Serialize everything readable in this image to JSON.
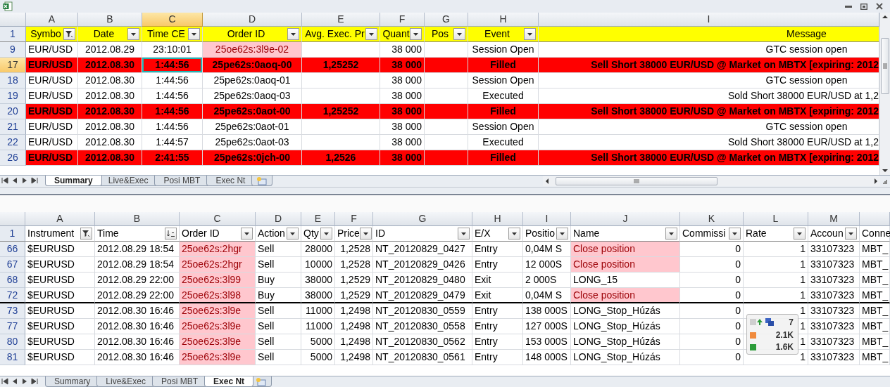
{
  "top_sheet": {
    "columns": [
      {
        "letter": "A",
        "heading": "Symbo",
        "kind": "filter",
        "selected": false
      },
      {
        "letter": "B",
        "heading": "Date",
        "kind": "dropdown",
        "selected": false
      },
      {
        "letter": "C",
        "heading": "Time CE",
        "kind": "dropdown",
        "selected": true
      },
      {
        "letter": "D",
        "heading": "Order ID",
        "kind": "dropdown",
        "selected": false
      },
      {
        "letter": "E",
        "heading": "Avg. Exec. Pr",
        "kind": "dropdown",
        "selected": false
      },
      {
        "letter": "F",
        "heading": "Quant",
        "kind": "dropdown",
        "selected": false
      },
      {
        "letter": "G",
        "heading": "Pos",
        "kind": "dropdown",
        "selected": false
      },
      {
        "letter": "H",
        "heading": "Event",
        "kind": "dropdown",
        "selected": false
      },
      {
        "letter": "I",
        "heading": "Message",
        "selected": false
      }
    ],
    "header_row": "1",
    "rows": [
      {
        "number": "9",
        "kind": "normal",
        "selected": false,
        "cells": [
          "EUR/USD",
          "2012.08.29",
          "23:10:01",
          {
            "text": "25oe62s:3l9e-02",
            "highlight": true
          },
          null,
          "38 000",
          null,
          "Session Open",
          "GTC session open"
        ]
      },
      {
        "number": "17",
        "kind": "filled",
        "selected": true,
        "cells": [
          "EUR/USD",
          "2012.08.30",
          {
            "text": "1:44:56",
            "active": true
          },
          "25pe62s:0aoq-00",
          "1,25252",
          "38 000",
          null,
          "Filled",
          "Sell Short 38000 EUR/USD @ Market on MBTX [expiring: 2012"
        ]
      },
      {
        "number": "18",
        "kind": "normal",
        "selected": false,
        "cells": [
          "EUR/USD",
          "2012.08.30",
          "1:44:56",
          "25pe62s:0aoq-01",
          null,
          "38 000",
          null,
          "Session Open",
          "GTC session open"
        ]
      },
      {
        "number": "19",
        "kind": "normal",
        "selected": false,
        "cells": [
          "EUR/USD",
          "2012.08.30",
          "1:44:56",
          "25pe62s:0aoq-03",
          null,
          "38 000",
          null,
          "Executed",
          "Sold Short 38000 EUR/USD at 1,2"
        ]
      },
      {
        "number": "20",
        "kind": "filled",
        "selected": false,
        "cells": [
          "EUR/USD",
          "2012.08.30",
          "1:44:56",
          "25pe62s:0aot-00",
          "1,25252",
          "38 000",
          null,
          "Filled",
          "Sell Short 38000 EUR/USD @ Market on MBTX [expiring: 2012"
        ]
      },
      {
        "number": "21",
        "kind": "normal",
        "selected": false,
        "cells": [
          "EUR/USD",
          "2012.08.30",
          "1:44:56",
          "25pe62s:0aot-01",
          null,
          "38 000",
          null,
          "Session Open",
          "GTC session open"
        ]
      },
      {
        "number": "22",
        "kind": "normal",
        "selected": false,
        "cells": [
          "EUR/USD",
          "2012.08.30",
          "1:44:57",
          "25pe62s:0aot-03",
          null,
          "38 000",
          null,
          "Executed",
          "Sold Short 38000 EUR/USD at 1,2"
        ]
      },
      {
        "number": "26",
        "kind": "filled",
        "selected": false,
        "cells": [
          "EUR/USD",
          "2012.08.30",
          "2:41:55",
          "25pe62s:0jch-00",
          "1,2526",
          "38 000",
          null,
          "Filled",
          "Sell Short 38000 EUR/USD @ Market on MBTX [expiring: 2012"
        ]
      }
    ],
    "tabs": [
      {
        "label": "Summary",
        "selected": true
      },
      {
        "label": "Live&Exec",
        "selected": false
      },
      {
        "label": "Posi MBT",
        "selected": false
      },
      {
        "label": "Exec Nt",
        "selected": false
      }
    ]
  },
  "bottom_sheet": {
    "columns": [
      {
        "letter": "A",
        "heading": "Instrument",
        "kind": "filter",
        "selected": false
      },
      {
        "letter": "B",
        "heading": "Time",
        "kind": "sort",
        "selected": false
      },
      {
        "letter": "C",
        "heading": "Order ID",
        "kind": "dropdown",
        "selected": false
      },
      {
        "letter": "D",
        "heading": "Action",
        "kind": "dropdown",
        "selected": false
      },
      {
        "letter": "E",
        "heading": "Qty",
        "kind": "dropdown",
        "selected": false
      },
      {
        "letter": "F",
        "heading": "Price",
        "kind": "dropdown",
        "selected": false
      },
      {
        "letter": "G",
        "heading": "ID",
        "kind": "dropdown",
        "selected": false
      },
      {
        "letter": "H",
        "heading": "E/X",
        "kind": "dropdown",
        "selected": false
      },
      {
        "letter": "I",
        "heading": "Positio",
        "kind": "dropdown",
        "selected": false
      },
      {
        "letter": "J",
        "heading": "Name",
        "kind": "dropdown",
        "selected": false
      },
      {
        "letter": "K",
        "heading": "Commissi",
        "kind": "dropdown",
        "selected": false
      },
      {
        "letter": "L",
        "heading": "Rate",
        "kind": "dropdown",
        "selected": false
      },
      {
        "letter": "M",
        "heading": "Accoun",
        "kind": "dropdown",
        "selected": false
      },
      {
        "heading": "Conne",
        "selected": false
      }
    ],
    "header_row": "1",
    "rows": [
      {
        "number": "66",
        "selected": false,
        "border_below": false,
        "cells": [
          "$EURUSD",
          "2012.08.29 18:54",
          {
            "text": "25oe62s:2hgr",
            "highlight": true
          },
          "Sell",
          "28000",
          "1,2528",
          "NT_20120829_0427",
          "Entry",
          "0,04M S",
          {
            "text": "Close position",
            "highlight": true
          },
          "0",
          "1",
          "33107323",
          "MBT_"
        ]
      },
      {
        "number": "67",
        "selected": false,
        "border_below": false,
        "cells": [
          "$EURUSD",
          "2012.08.29 18:54",
          {
            "text": "25oe62s:2hgr",
            "highlight": true
          },
          "Sell",
          "10000",
          "1,2528",
          "NT_20120829_0426",
          "Entry",
          "12 000S",
          {
            "text": "Close position",
            "highlight": true
          },
          "0",
          "1",
          "33107323",
          "MBT_"
        ]
      },
      {
        "number": "68",
        "selected": false,
        "border_below": false,
        "cells": [
          "$EURUSD",
          "2012.08.29 22:00",
          {
            "text": "25oe62s:3l99",
            "highlight": true
          },
          "Buy",
          "38000",
          "1,2529",
          "NT_20120829_0480",
          "Exit",
          "2 000S",
          "LONG_15",
          "0",
          "1",
          "33107323",
          "MBT_"
        ]
      },
      {
        "number": "72",
        "selected": false,
        "border_below": true,
        "cells": [
          "$EURUSD",
          "2012.08.29 22:00",
          {
            "text": "25oe62s:3l98",
            "highlight": true
          },
          "Buy",
          "38000",
          "1,2529",
          "NT_20120829_0479",
          "Exit",
          "0,04M S",
          {
            "text": "Close position",
            "highlight": true
          },
          "0",
          "1",
          "33107323",
          "MBT_"
        ]
      },
      {
        "number": "73",
        "selected": false,
        "border_below": false,
        "cells": [
          "$EURUSD",
          "2012.08.30 16:46",
          {
            "text": "25oe62s:3l9e",
            "highlight": true
          },
          "Sell",
          "11000",
          "1,2498",
          "NT_20120830_0559",
          "Entry",
          "138 000S",
          "LONG_Stop_Húzás",
          "0",
          "1",
          "33107323",
          "MBT_"
        ]
      },
      {
        "number": "77",
        "selected": false,
        "border_below": false,
        "cells": [
          "$EURUSD",
          "2012.08.30 16:46",
          {
            "text": "25oe62s:3l9e",
            "highlight": true
          },
          "Sell",
          "11000",
          "1,2498",
          "NT_20120830_0558",
          "Entry",
          "127 000S",
          "LONG_Stop_Húzás",
          "0",
          "1",
          "33107323",
          "MBT_"
        ]
      },
      {
        "number": "80",
        "selected": false,
        "border_below": false,
        "cells": [
          "$EURUSD",
          "2012.08.30 16:46",
          {
            "text": "25oe62s:3l9e",
            "highlight": true
          },
          "Sell",
          "5000",
          "1,2498",
          "NT_20120830_0562",
          "Entry",
          "153 000S",
          "LONG_Stop_Húzás",
          "0",
          "1",
          "33107323",
          "MBT_"
        ]
      },
      {
        "number": "81",
        "selected": false,
        "border_below": false,
        "cells": [
          "$EURUSD",
          "2012.08.30 16:46",
          {
            "text": "25oe62s:3l9e",
            "highlight": true
          },
          "Sell",
          "5000",
          "1,2498",
          "NT_20120830_0561",
          "Entry",
          "148 000S",
          "LONG_Stop_Húzás",
          "0",
          "1",
          "33107323",
          "MBT_"
        ]
      }
    ],
    "tabs": [
      {
        "label": "Summary",
        "selected": false
      },
      {
        "label": "Live&Exec",
        "selected": false
      },
      {
        "label": "Posi MBT",
        "selected": false
      },
      {
        "label": "Exec Nt",
        "selected": true
      }
    ]
  },
  "overlay": {
    "counts": [
      "7",
      "2.1K",
      "1.6K"
    ]
  }
}
